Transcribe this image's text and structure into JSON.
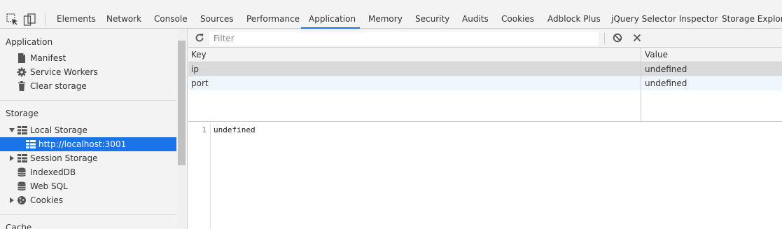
{
  "tabs": [
    {
      "label": "Elements"
    },
    {
      "label": "Network"
    },
    {
      "label": "Console"
    },
    {
      "label": "Sources"
    },
    {
      "label": "Performance"
    },
    {
      "label": "Application",
      "active": true
    },
    {
      "label": "Memory"
    },
    {
      "label": "Security"
    },
    {
      "label": "Audits"
    },
    {
      "label": "Cookies"
    },
    {
      "label": "Adblock Plus"
    },
    {
      "label": "jQuery Selector Inspector"
    },
    {
      "label": "Storage Explorer"
    }
  ],
  "sidebar": {
    "application_title": "Application",
    "application_items": [
      {
        "label": "Manifest",
        "icon": "document-icon"
      },
      {
        "label": "Service Workers",
        "icon": "gear-icon"
      },
      {
        "label": "Clear storage",
        "icon": "trash-icon"
      }
    ],
    "storage_title": "Storage",
    "local_storage": "Local Storage",
    "local_storage_origin": "http://localhost:3001",
    "session_storage": "Session Storage",
    "indexeddb": "IndexedDB",
    "websql": "Web SQL",
    "cookies": "Cookies",
    "cache_title": "Cache"
  },
  "toolbar": {
    "filter_placeholder": "Filter"
  },
  "grid": {
    "key_header": "Key",
    "value_header": "Value",
    "rows": [
      {
        "key": "ip",
        "value": "undefined",
        "selected": true
      },
      {
        "key": "port",
        "value": "undefined"
      }
    ]
  },
  "viewer": {
    "line_number": "1",
    "content": "undefined"
  },
  "colors": {
    "accent": "#1a73e8",
    "selected_row": "#dadada",
    "alt_row": "#f0f6fe"
  }
}
